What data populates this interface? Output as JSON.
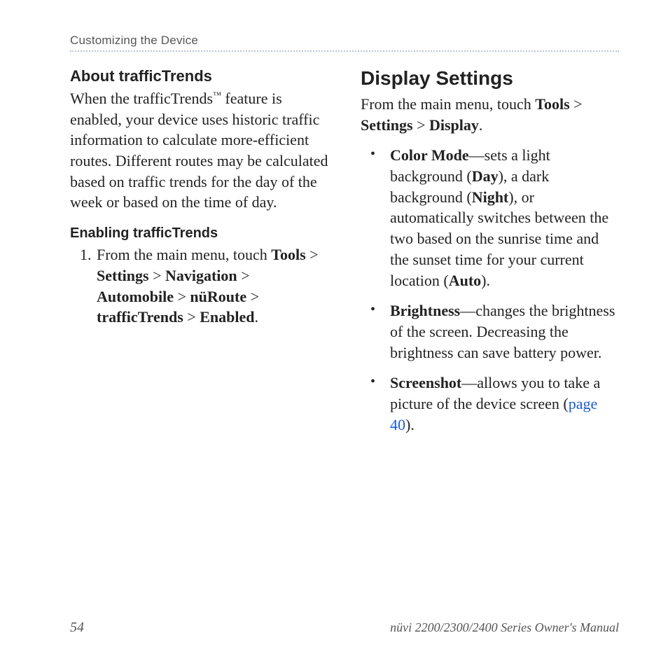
{
  "header": {
    "section": "Customizing the Device"
  },
  "left": {
    "h1": "About trafficTrends",
    "p1_a": "When the trafficTrends",
    "p1_tm": "™",
    "p1_b": " feature is enabled, your device uses historic traffic information to calculate more-efficient routes. Different routes may be calculated based on traffic trends for the day of the week or based on the time of day.",
    "h2": "Enabling trafficTrends",
    "step_intro": "From the main menu, touch ",
    "path": {
      "p1": "Tools",
      "p2": "Settings",
      "p3": "Navigation",
      "p4": "Automobile",
      "p5": "nüRoute",
      "p6": "trafficTrends",
      "p7": "Enabled"
    },
    "sep": " > "
  },
  "right": {
    "h1": "Display Settings",
    "intro_a": "From the main menu, touch ",
    "intro_tools": "Tools",
    "intro_sep": " > ",
    "intro_settings": "Settings",
    "intro_display": "Display",
    "intro_dot": ".",
    "items": {
      "color": {
        "name": "Color Mode",
        "t1": "—sets a light background (",
        "day": "Day",
        "t2": "), a dark background (",
        "night": "Night",
        "t3": "), or automatically switches between the two based on the sunrise time and the sunset time for your current location (",
        "auto": "Auto",
        "t4": ")."
      },
      "bright": {
        "name": "Brightness",
        "t1": "—changes the brightness of the screen. Decreasing the brightness can save battery power."
      },
      "shot": {
        "name": "Screenshot",
        "t1": "—allows you to take a picture of the device screen (",
        "link": "page 40",
        "t2": ")."
      }
    }
  },
  "footer": {
    "page": "54",
    "manual": "nüvi 2200/2300/2400 Series Owner's Manual"
  }
}
